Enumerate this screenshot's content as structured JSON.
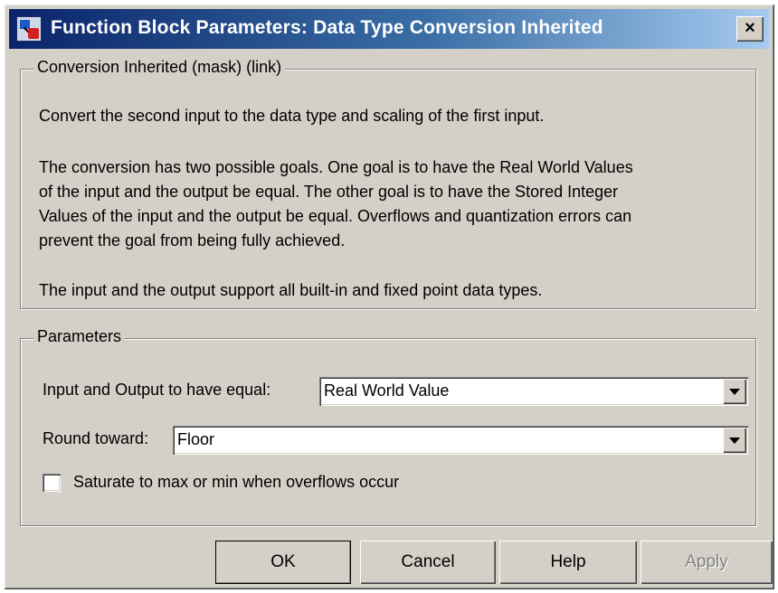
{
  "window": {
    "title": "Function Block Parameters: Data Type Conversion Inherited",
    "close_label": "×"
  },
  "description_group": {
    "legend": "Conversion Inherited (mask) (link)",
    "lines": [
      "Convert the second input to the data type and scaling of the first input.",
      "The conversion has two possible goals.  One goal is to have the Real World Values",
      "of the input and the output be equal.  The other goal is to have the Stored Integer",
      "Values of the input and the output be equal.  Overflows and quantization errors can",
      "prevent the goal from being fully achieved.",
      "The input and the output support all built-in and fixed point data types."
    ]
  },
  "parameters_group": {
    "legend": "Parameters",
    "equal_label": "Input and Output to have equal:",
    "equal_value": "Real World Value",
    "round_label": "Round toward:",
    "round_value": "Floor",
    "saturate_label": "Saturate to max or min when overflows occur",
    "saturate_checked": false
  },
  "buttons": {
    "ok": "OK",
    "cancel": "Cancel",
    "help": "Help",
    "apply": "Apply"
  }
}
